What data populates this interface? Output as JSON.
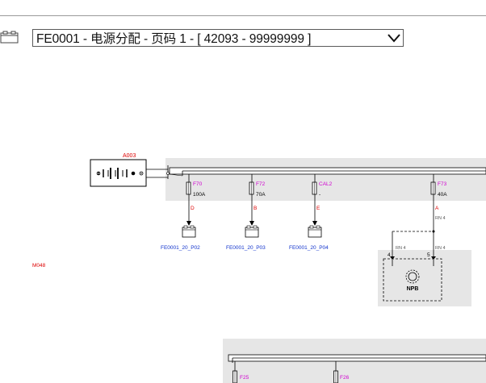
{
  "header": {
    "title": "FE0001 - 电源分配 - 页码 1 - [ 42093 - 99999999 ]",
    "selector_icon": "chevron-down-icon",
    "doc_icon": "document-icon"
  },
  "diagram": {
    "battery_label": "A003",
    "page_marker": "M048",
    "fuses": [
      {
        "name": "F70",
        "rating": "100A",
        "pin": "D",
        "connector": "FE0001_20_P02"
      },
      {
        "name": "F72",
        "rating": "70A",
        "pin": "B",
        "connector": "FE0001_20_P03"
      },
      {
        "name": "CAL2",
        "rating": "-",
        "pin": "E",
        "connector": "FE0001_20_P04"
      },
      {
        "name": "F73",
        "rating": "40A",
        "pin": "A",
        "wire": "RN 4"
      }
    ],
    "npb": {
      "label": "NPB",
      "pin_left": "4",
      "pin_right": "5",
      "wire_left": "RN 4",
      "wire_right": "RN 4"
    },
    "lower_fuses": [
      "F25",
      "F26"
    ],
    "colors": {
      "fuse_name": "#d000d0",
      "pin_label": "#dd0000",
      "link": "#1133cc",
      "panel": "#e6e6e6",
      "wire_label": "#555555"
    }
  }
}
